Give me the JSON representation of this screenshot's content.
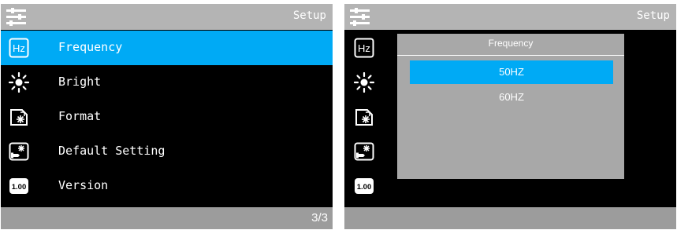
{
  "left_screen": {
    "title": "Setup",
    "menu": [
      {
        "label": "Frequency",
        "icon": "hz-icon",
        "selected": true
      },
      {
        "label": "Bright",
        "icon": "brightness-icon",
        "selected": false
      },
      {
        "label": "Format",
        "icon": "format-icon",
        "selected": false
      },
      {
        "label": "Default Setting",
        "icon": "default-setting-icon",
        "selected": false
      },
      {
        "label": "Version",
        "icon": "version-icon",
        "selected": false
      }
    ],
    "page": "3/3"
  },
  "right_screen": {
    "title": "Setup",
    "dialog": {
      "title": "Frequency",
      "options": [
        {
          "label": "50HZ",
          "selected": true
        },
        {
          "label": "60HZ",
          "selected": false
        }
      ]
    }
  },
  "colors": {
    "accent": "#00aaf5",
    "screen_bg": "#000000",
    "bar_bg": "#b4b4b4",
    "dialog_bg": "#a8a8a8"
  },
  "icon_text": {
    "hz": "Hz",
    "version": "1.00"
  }
}
